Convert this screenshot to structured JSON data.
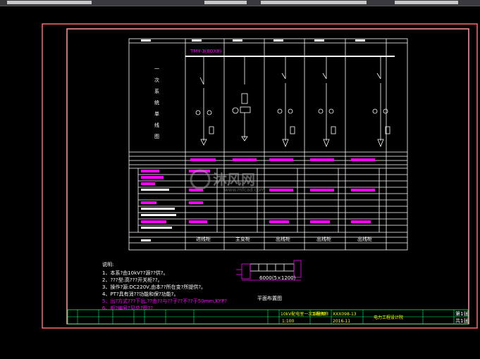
{
  "diagram": {
    "side_title": "一次系统单线图",
    "busbar_label": "TMY-3(80X8)",
    "feeder_labels": [
      "进线柜",
      "主变柜",
      "出线柜",
      "出线柜",
      "出线柜"
    ],
    "notes_title": "说明:",
    "notes": [
      "1、本系?由10kV??源??供?。",
      "2、???型:高???开关柜??。",
      "3、操作?源:DC220V,由本??所在变?所提供?。",
      "4、PT?具有消??功能和保?功能?。",
      "5、出?方式???下出,??由??与??子??不??于50mm,KYP?",
      "6、柜?编号?见总?图??"
    ],
    "plan_title": "平面布置图",
    "plan_dimension": "6000(5×1200)",
    "watermark": "沐风网",
    "watermark_url": "www.mfcad.com",
    "title_block": {
      "drawing_name": "10kV配电室一次系统图",
      "project_label": "工程名称",
      "drawing_no": "XXX098-13",
      "scale": "1:100",
      "date": "2016-11",
      "sheet": "第1张",
      "total": "共1张",
      "company": "电力工程设计院"
    }
  }
}
